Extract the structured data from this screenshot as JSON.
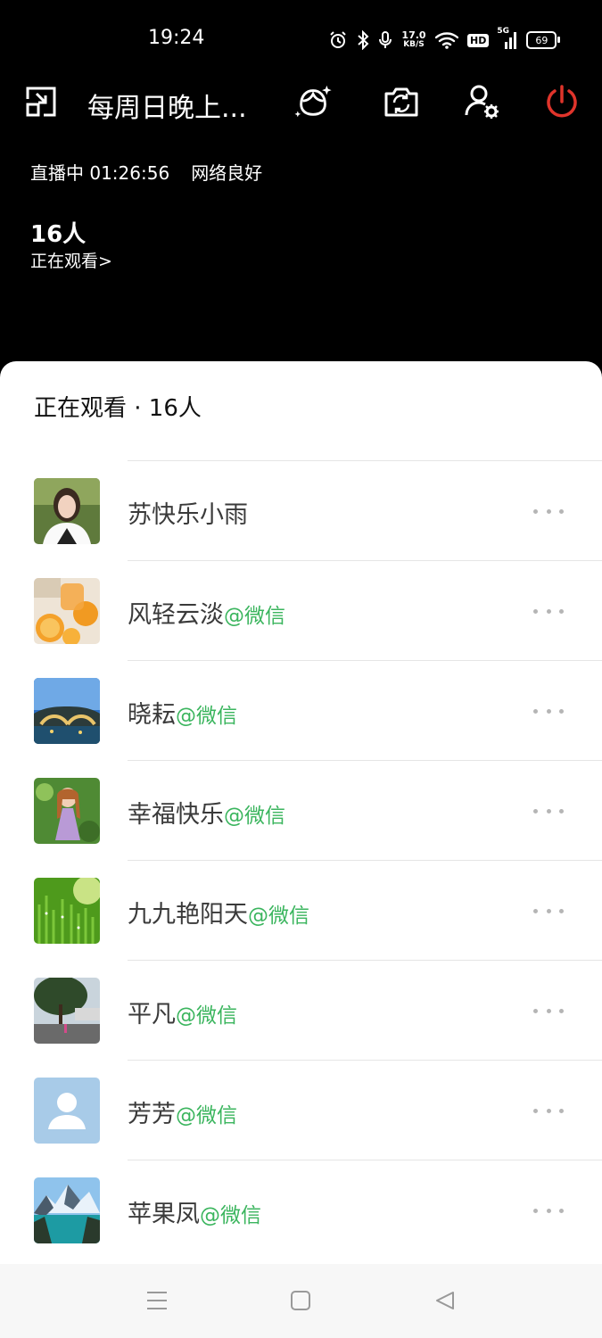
{
  "status_bar": {
    "time": "19:24",
    "net_speed_value": "17.0",
    "net_speed_unit": "KB/S",
    "hd_label": "HD",
    "signal_label": "5G",
    "battery": "69"
  },
  "header": {
    "title": "每周日晚上...",
    "live_label": "直播中 01:26:56",
    "network_label": "网络良好",
    "viewer_count": "16人",
    "viewer_link": "正在观看>"
  },
  "sheet": {
    "title": "正在观看 · 16人",
    "viewers": [
      {
        "name": "苏快乐小雨",
        "suffix": ""
      },
      {
        "name": "风轻云淡",
        "suffix": "@微信"
      },
      {
        "name": "晓耘",
        "suffix": "@微信"
      },
      {
        "name": "幸福快乐",
        "suffix": "@微信"
      },
      {
        "name": "九九艳阳天",
        "suffix": "@微信"
      },
      {
        "name": "平凡",
        "suffix": "@微信"
      },
      {
        "name": "芳芳",
        "suffix": "@微信"
      },
      {
        "name": "苹果凤",
        "suffix": "@微信"
      }
    ]
  },
  "colors": {
    "accent_green": "#3bb55e",
    "power_red": "#e0342b"
  },
  "icons": [
    "minimize-icon",
    "beauty-icon",
    "flip-camera-icon",
    "user-settings-icon",
    "power-icon",
    "more-icon",
    "menu-icon",
    "home-icon",
    "back-icon"
  ]
}
